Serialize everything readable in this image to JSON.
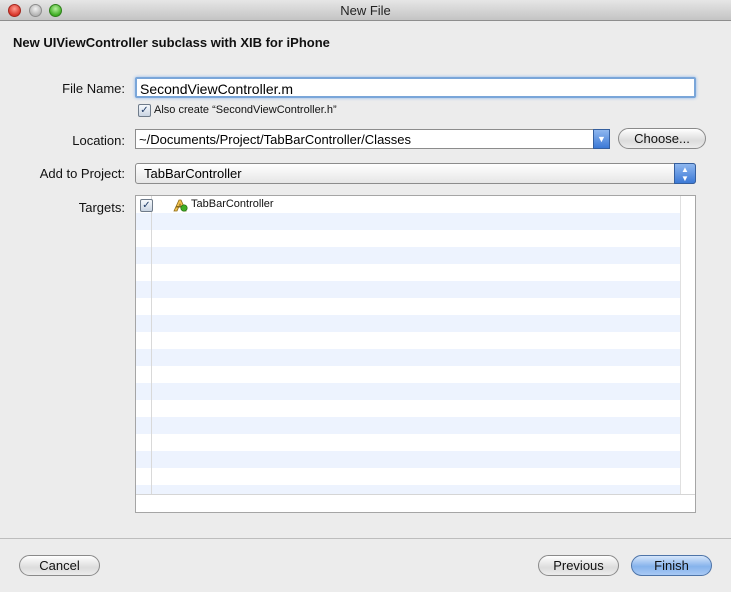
{
  "window": {
    "title": "New File"
  },
  "heading": "New UIViewController subclass with XIB for iPhone",
  "file_name": {
    "label": "File Name:",
    "value": "SecondViewController.m"
  },
  "also_create": {
    "checked": true,
    "label": "Also create “SecondViewController.h”"
  },
  "location": {
    "label": "Location:",
    "value": "~/Documents/Project/TabBarController/Classes",
    "choose_label": "Choose..."
  },
  "add_to_project": {
    "label": "Add to Project:",
    "value": "TabBarController"
  },
  "targets": {
    "label": "Targets:",
    "items": [
      {
        "checked": true,
        "name": "TabBarController"
      }
    ]
  },
  "buttons": {
    "cancel": "Cancel",
    "previous": "Previous",
    "finish": "Finish"
  }
}
